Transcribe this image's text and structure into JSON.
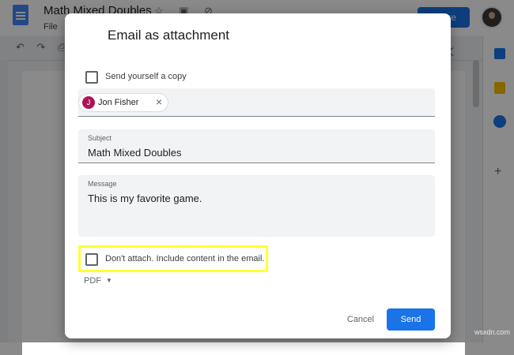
{
  "app": {
    "doc_title": "Math Mixed Doubles",
    "menu_file": "File",
    "share_label": "Share"
  },
  "dialog": {
    "title": "Email as attachment",
    "send_copy_label": "Send yourself a copy",
    "recipient": {
      "initial": "J",
      "name": "Jon Fisher"
    },
    "subject": {
      "label": "Subject",
      "value": "Math Mixed Doubles"
    },
    "message": {
      "label": "Message",
      "value": "This is my favorite game."
    },
    "dont_attach_label": "Don't attach. Include content in the email.",
    "format": "PDF",
    "cancel_label": "Cancel",
    "send_label": "Send"
  },
  "watermark": "wsxdn.com",
  "colors": {
    "primary": "#1a73e8",
    "chip_avatar": "#ad1457",
    "highlight": "#ffff33"
  }
}
